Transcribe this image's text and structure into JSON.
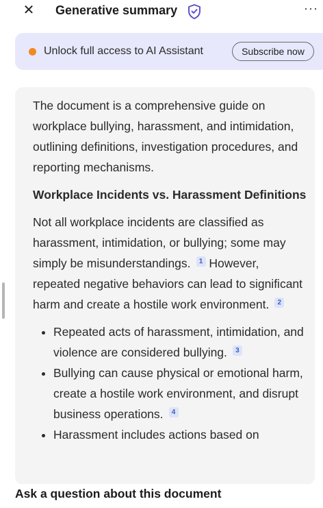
{
  "header": {
    "close_icon": "close-icon",
    "title": "Generative summary",
    "shield_icon": "shield-check-icon",
    "more_icon": "more-options-icon",
    "more_glyph": "···"
  },
  "banner": {
    "status_color": "#f08a21",
    "text": "Unlock full access to AI Assistant",
    "subscribe_label": "Subscribe now"
  },
  "summary": {
    "intro": "The document is a comprehensive guide on workplace bullying, harassment, and intimidation, outlining definitions, investigation procedures, and reporting mechanisms.",
    "heading": "Workplace Incidents vs. Harassment Definitions",
    "para_part1": "Not all workplace incidents are classified as harassment, intimidation, or bullying; some may simply be misunderstandings.",
    "cite1": "1",
    "para_part2": "However, repeated negative behaviors can lead to significant harm and create a hostile work environment.",
    "cite2": "2",
    "bullets": [
      {
        "text": "Repeated acts of harassment, intimidation, and violence are considered bullying.",
        "cite": "3"
      },
      {
        "text": "Bullying can cause physical or emotional harm, create a hostile work environment, and disrupt business operations.",
        "cite": "4"
      },
      {
        "text": "Harassment includes actions based on",
        "cite": ""
      }
    ]
  },
  "ask": {
    "placeholder": "Ask a question about this document"
  }
}
